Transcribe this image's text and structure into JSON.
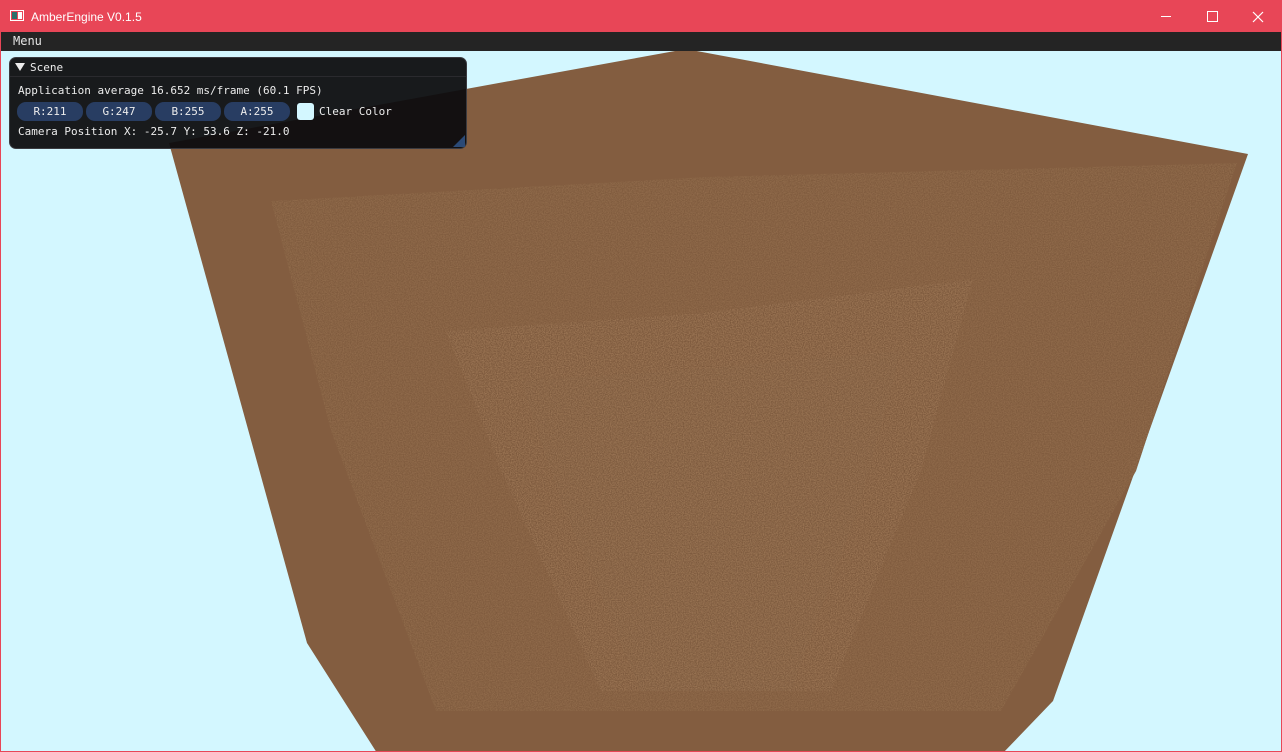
{
  "window": {
    "title": "AmberEngine V0.1.5",
    "accent_color": "#e84657",
    "icons": [
      "app-icon",
      "minimize-icon",
      "maximize-icon",
      "close-icon"
    ]
  },
  "menubar": {
    "menu_label": "Menu"
  },
  "scene_panel": {
    "title": "Scene",
    "frame_stats": "Application average 16.652 ms/frame (60.1 FPS)",
    "clear_color": {
      "r_label": "R:211",
      "g_label": "G:247",
      "b_label": "B:255",
      "a_label": "A:255",
      "swatch_color": "#d3f7ff",
      "label": "Clear Color"
    },
    "camera_position": "Camera Position X: -25.7 Y: 53.6 Z: -21.0"
  },
  "viewport": {
    "background_color": "#d3f7ff",
    "object": "textured-cube",
    "object_color": "#835d40"
  }
}
